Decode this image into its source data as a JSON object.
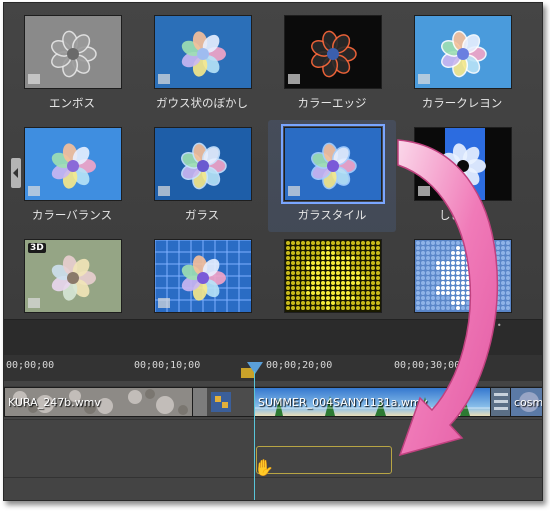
{
  "effects": [
    {
      "label": "エンボス",
      "style": "emboss"
    },
    {
      "label": "ガウス状のぼかし",
      "style": "blur"
    },
    {
      "label": "カラーエッジ",
      "style": "edge"
    },
    {
      "label": "カラークレヨン",
      "style": "crayon"
    },
    {
      "label": "カラーバランス",
      "style": "balance"
    },
    {
      "label": "ガラス",
      "style": "glass"
    },
    {
      "label": "ガラスタイル",
      "style": "glasstile",
      "selected": true
    },
    {
      "label": "しきい値",
      "style": "threshold"
    },
    {
      "label": "",
      "style": "badge3d",
      "badge": "3D"
    },
    {
      "label": "",
      "style": "grid"
    },
    {
      "label": "",
      "style": "yellowdots"
    },
    {
      "label": "",
      "style": "bluedots"
    }
  ],
  "timeline": {
    "ruler_labels": [
      "00;00;00",
      "00;00;10;00",
      "00;00;20;00",
      "00;00;30;00"
    ],
    "clips": [
      {
        "label": "KURA_247b.wmv",
        "kind": "flowers"
      },
      {
        "label": "",
        "kind": "transition"
      },
      {
        "label": "SUMMER_004SANY1131a.wmv",
        "kind": "beach"
      },
      {
        "label": "",
        "kind": "sand"
      },
      {
        "label": "cosm",
        "kind": "cosmos"
      }
    ]
  },
  "colors": {
    "arrow_pink": "#f078b4",
    "playhead": "#5a9fd8",
    "selection": "#7aa6ff"
  },
  "icons": {
    "collapse": "chevron-left-icon",
    "cursor": "hand-cursor-icon"
  }
}
